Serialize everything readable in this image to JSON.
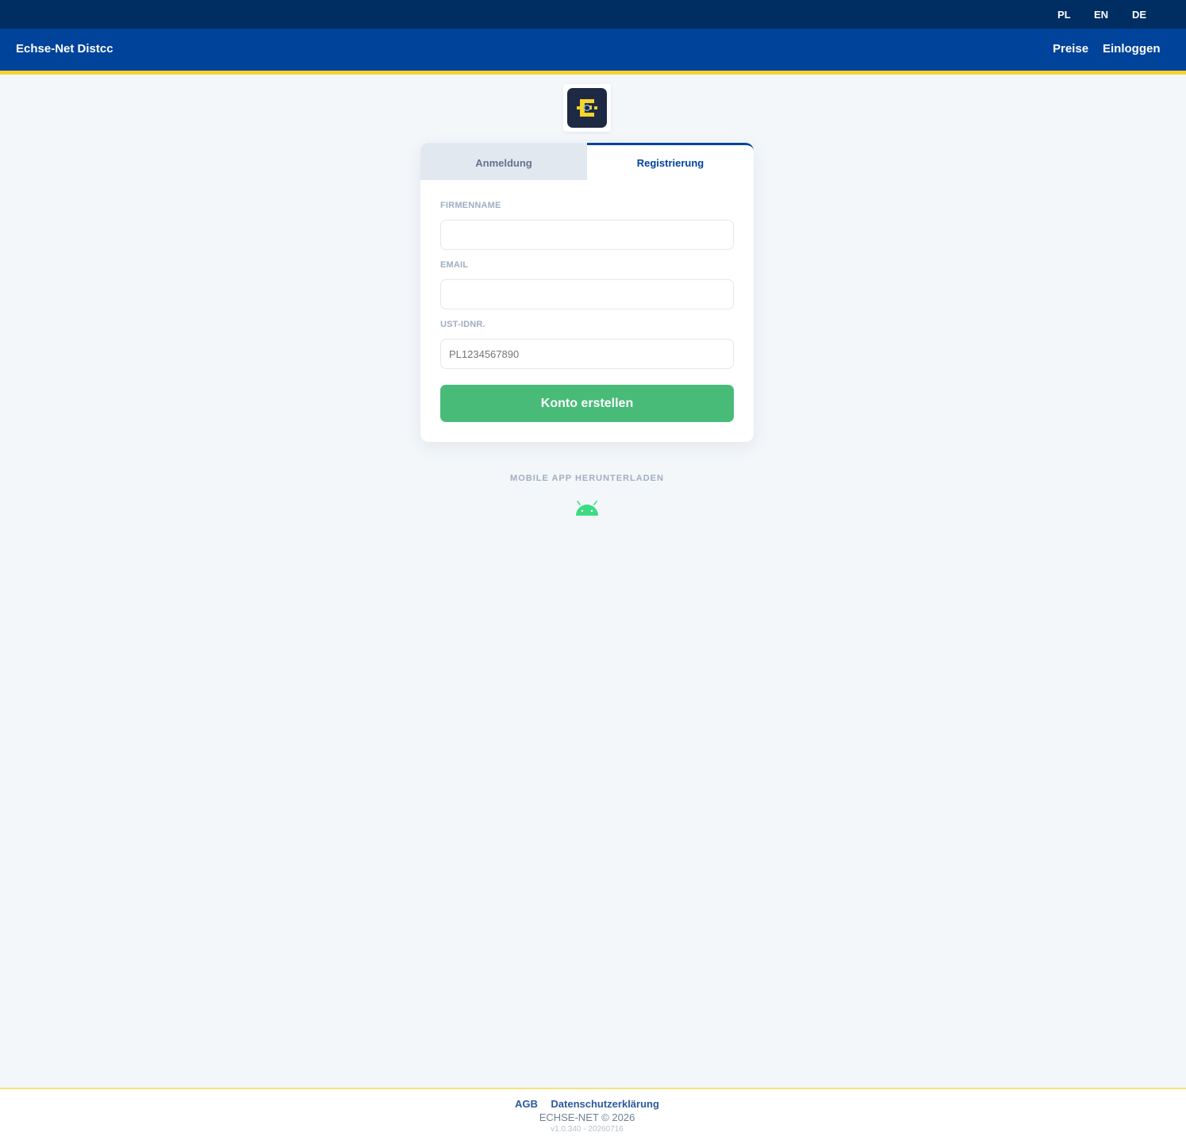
{
  "languages": [
    "PL",
    "EN",
    "DE"
  ],
  "header": {
    "brand": "Echse-Net Distcc",
    "nav": {
      "pricing": "Preise",
      "login": "Einloggen"
    }
  },
  "tabs": {
    "login": "Anmeldung",
    "register": "Registrierung",
    "active": "register"
  },
  "form": {
    "company": {
      "label": "FIRMENNAME",
      "value": "",
      "placeholder": ""
    },
    "email": {
      "label": "EMAIL",
      "value": "",
      "placeholder": ""
    },
    "vat": {
      "label": "UST-IDNR.",
      "value": "",
      "placeholder": "PL1234567890"
    },
    "submit_label": "Konto erstellen"
  },
  "mobile": {
    "title": "MOBILE APP HERUNTERLADEN",
    "platform_icon": "android-icon"
  },
  "footer": {
    "links": {
      "terms": "AGB",
      "privacy": "Datenschutzerklärung"
    },
    "copyright": "ECHSE-NET © 2026",
    "version": "v1.0.340 - 20260716"
  },
  "colors": {
    "topbar": "#002d62",
    "navbar": "#00439a",
    "accent_yellow": "#f6d32d",
    "submit_green": "#48bb78",
    "android_green": "#3ddc84"
  }
}
